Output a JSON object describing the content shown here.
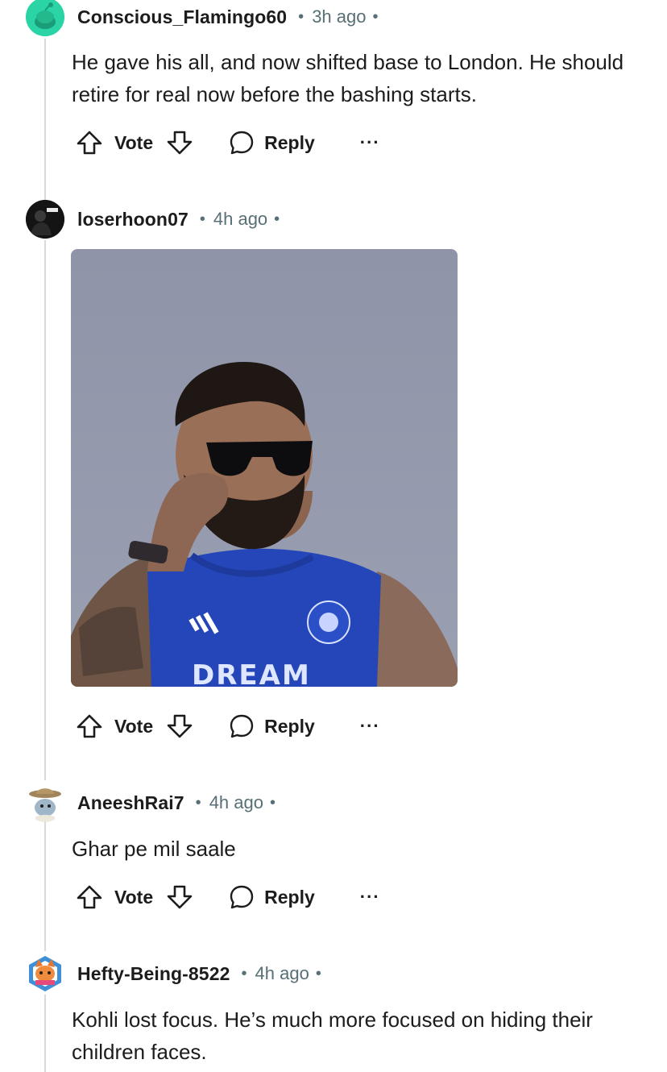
{
  "comments": [
    {
      "username": "Conscious_Flamingo60",
      "separator": "•",
      "time": "3h ago",
      "avatar_icon": "snoo-green-avatar-icon",
      "text": "He gave his all, and now shifted base to London. He should retire for real now before the bashing starts.",
      "actions": {
        "vote": "Vote",
        "reply": "Reply",
        "more": "···"
      }
    },
    {
      "username": "loserhoon07",
      "separator": "•",
      "time": "4h ago",
      "avatar_icon": "dark-photo-avatar-icon",
      "image": {
        "jersey_text": "DREAM"
      },
      "actions": {
        "vote": "Vote",
        "reply": "Reply",
        "more": "···"
      }
    },
    {
      "username": "AneeshRai7",
      "separator": "•",
      "time": "4h ago",
      "avatar_icon": "snoo-cowboy-hat-avatar-icon",
      "text": "Ghar pe mil saale",
      "actions": {
        "vote": "Vote",
        "reply": "Reply",
        "more": "···"
      }
    },
    {
      "username": "Hefty-Being-8522",
      "separator": "•",
      "time": "4h ago",
      "avatar_icon": "snoo-cat-avatar-icon",
      "text": "Kohli lost focus. He’s much more focused on hiding their children faces."
    }
  ],
  "colors": {
    "text": "#1c1c1c",
    "meta": "#576f76",
    "thread_line": "#d7dadc",
    "avatar_green": "#2bd4a4"
  }
}
